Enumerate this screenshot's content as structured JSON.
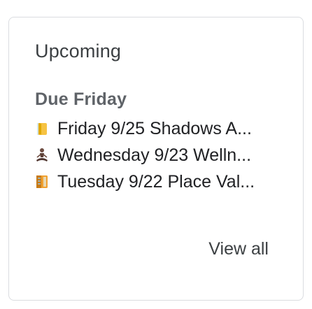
{
  "card": {
    "title": "Upcoming",
    "section_label": "Due Friday",
    "items": [
      {
        "icon": "folded-paper-icon",
        "label": "Friday 9/25 Shadows A..."
      },
      {
        "icon": "meditation-person-icon",
        "label": "Wednesday 9/23 Welln..."
      },
      {
        "icon": "books-icon",
        "label": "Tuesday 9/22 Place Val..."
      }
    ],
    "view_all_label": "View all"
  }
}
